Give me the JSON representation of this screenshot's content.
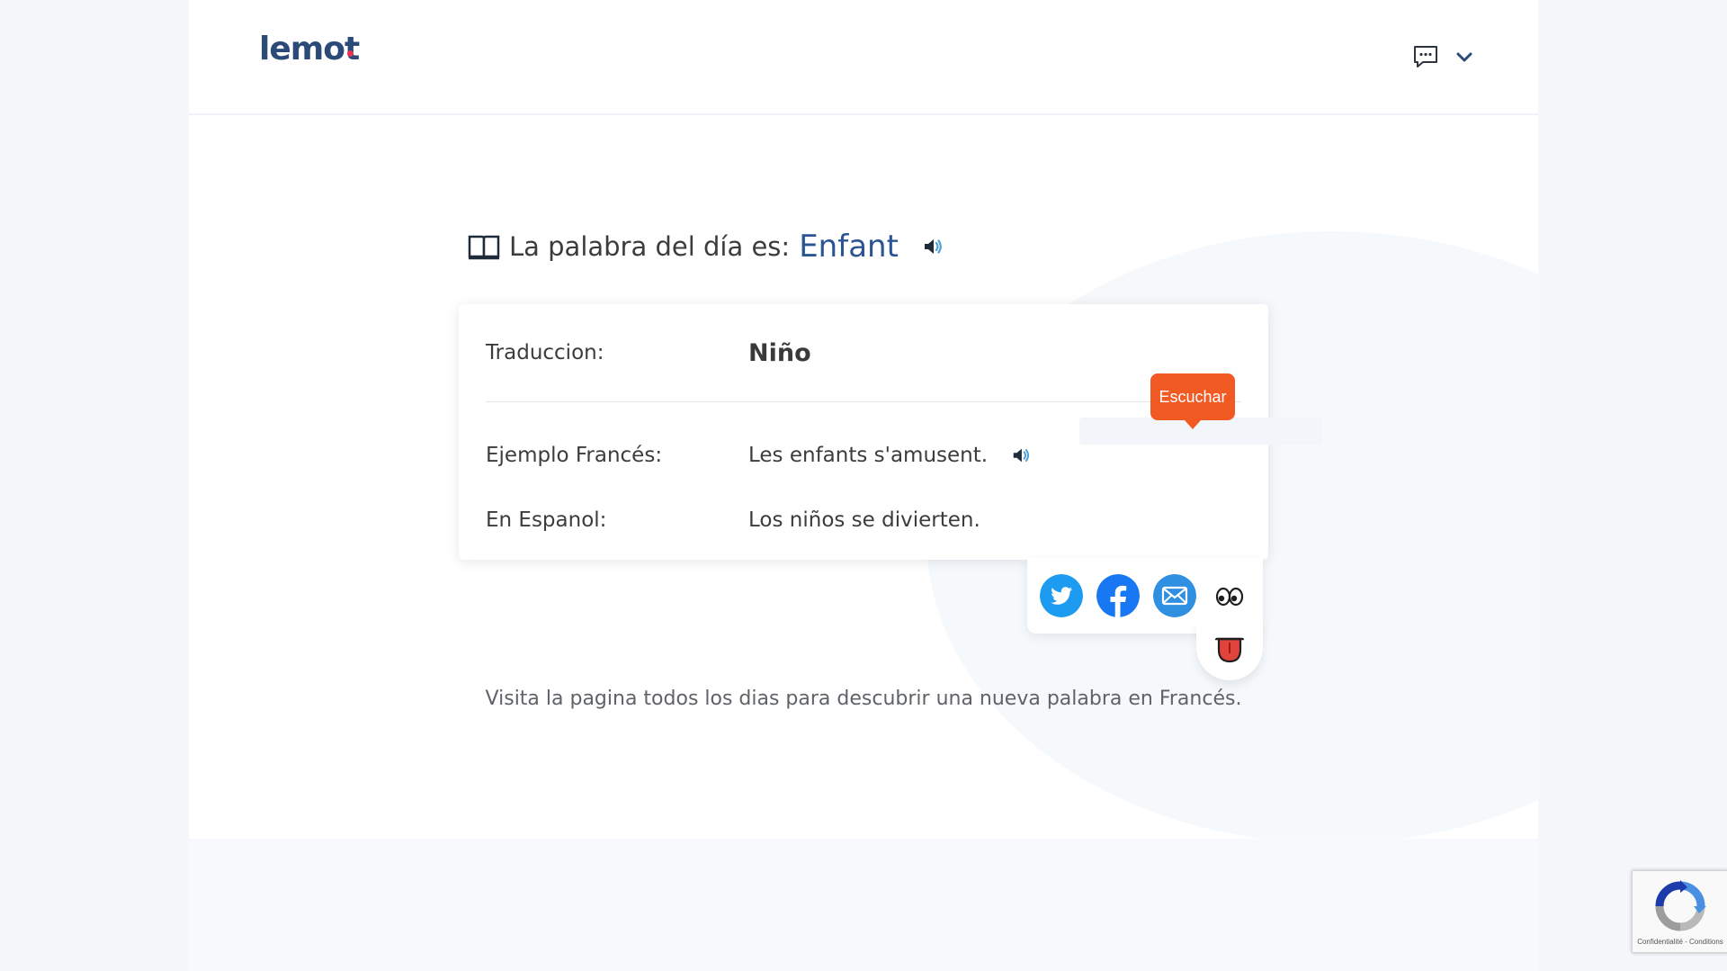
{
  "header": {
    "logo_text": "lemot",
    "icons": [
      "chat-icon",
      "chevron-down-icon"
    ]
  },
  "word_of_day": {
    "prefix": "La palabra del día es:",
    "word": "Enfant"
  },
  "card": {
    "translation_label": "Traduccion:",
    "translation_value": "Niño",
    "example_fr_label": "Ejemplo Francés:",
    "example_fr_value": "Les enfants s'amusent.",
    "example_es_label": "En Espanol:",
    "example_es_value": "Los niños se divierten."
  },
  "tooltip": {
    "text": "Escuchar"
  },
  "share": {
    "icons": [
      "twitter-icon",
      "facebook-icon",
      "email-icon",
      "eyes-emoji-icon",
      "tongue-emoji-icon"
    ]
  },
  "footer": {
    "text": "Visita la pagina todos los dias para descubrir una nueva palabra en Francés."
  },
  "recaptcha": {
    "links": "Confidentialité - Conditions"
  },
  "colors": {
    "brand_blue": "#2b4a78",
    "accent_word": "#2b5592",
    "tooltip_orange": "#f25a24",
    "twitter": "#1d9bf0",
    "facebook": "#1877f2",
    "email": "#2f8fe0",
    "logo_dot": "#e8344e"
  }
}
